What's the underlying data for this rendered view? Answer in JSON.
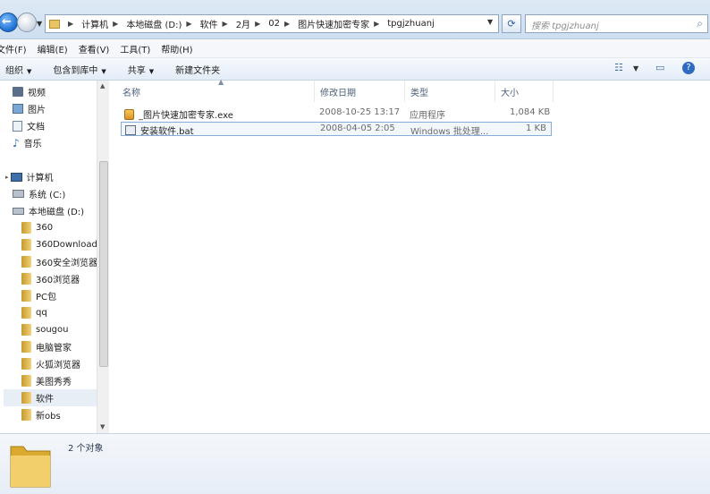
{
  "address": {
    "crumbs": [
      "计算机",
      "本地磁盘 (D:)",
      "软件",
      "2月",
      "02",
      "图片快速加密专家",
      "tpgjzhuanj"
    ]
  },
  "search": {
    "placeholder": "搜索 tpgjzhuanj"
  },
  "menu": [
    "文件(F)",
    "编辑(E)",
    "查看(V)",
    "工具(T)",
    "帮助(H)"
  ],
  "toolbar": {
    "organize": "组织",
    "include": "包含到库中",
    "share": "共享",
    "new_folder": "新建文件夹"
  },
  "nav": {
    "favorites": [
      "视频",
      "图片",
      "文档",
      "音乐"
    ],
    "computer": "计算机",
    "drives": [
      "系统 (C:)",
      "本地磁盘 (D:)"
    ],
    "folders": [
      "360",
      "360Download",
      "360安全浏览器",
      "360浏览器",
      "PC包",
      "qq",
      "sougou",
      "电脑管家",
      "火狐浏览器",
      "美图秀秀",
      "软件",
      "新obs"
    ]
  },
  "columns": {
    "name": "名称",
    "date": "修改日期",
    "type": "类型",
    "size": "大小"
  },
  "files": [
    {
      "name": "_图片快速加密专家.exe",
      "date": "2008-10-25 13:17",
      "type": "应用程序",
      "size": "1,084 KB"
    },
    {
      "name": "安装软件.bat",
      "date": "2008-04-05 2:05",
      "type": "Windows 批处理...",
      "size": "1 KB"
    }
  ],
  "status": {
    "count": "2 个对象"
  }
}
